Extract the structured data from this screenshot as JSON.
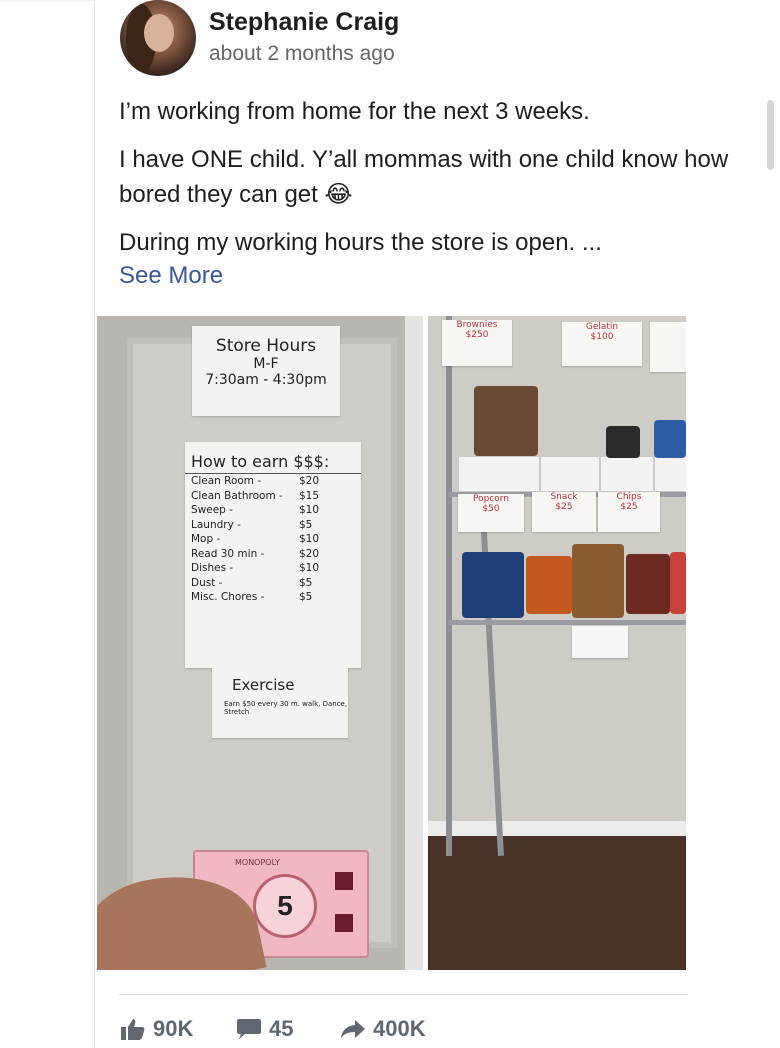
{
  "post": {
    "author": "Stephanie Craig",
    "timestamp": "about 2 months ago",
    "paragraphs": [
      "I’m working from home for the next 3 weeks.",
      "I have ONE child. Y’all mommas with one child know how bored they can get 😂",
      "During my working hours the store is open. ..."
    ],
    "see_more": "See More"
  },
  "photo_left": {
    "store_hours_title": "Store Hours",
    "store_hours_days": "M-F",
    "store_hours_time": "7:30am - 4:30pm",
    "earn_title": "How to earn $$$:",
    "chores": [
      {
        "task": "Clean Room -",
        "pay": "$20"
      },
      {
        "task": "Clean Bathroom -",
        "pay": "$15"
      },
      {
        "task": "Sweep -",
        "pay": "$10"
      },
      {
        "task": "Laundry -",
        "pay": "$5"
      },
      {
        "task": "Mop -",
        "pay": "$10"
      },
      {
        "task": "Read 30 min -",
        "pay": "$20"
      },
      {
        "task": "Dishes -",
        "pay": "$10"
      },
      {
        "task": "Dust -",
        "pay": "$5"
      },
      {
        "task": "Misc. Chores -",
        "pay": "$5"
      }
    ],
    "exercise_title": "Exercise",
    "exercise_note": "Earn $50 every 30 m. walk, Dance, Stretch",
    "money_brand": "MONOPOLY",
    "money_value": "5"
  },
  "photo_right": {
    "labels": [
      {
        "name": "Brownies",
        "price": "$250"
      },
      {
        "name": "Gelatin",
        "price": "$100"
      },
      {
        "name": "Popcorn",
        "price": "$50"
      },
      {
        "name": "Snack",
        "price": "$25"
      },
      {
        "name": "Chips",
        "price": "$25"
      }
    ]
  },
  "actions": {
    "likes": "90K",
    "comments": "45",
    "shares": "400K"
  },
  "colors": {
    "link": "#385898",
    "meta": "#65676b",
    "action": "#606770"
  }
}
